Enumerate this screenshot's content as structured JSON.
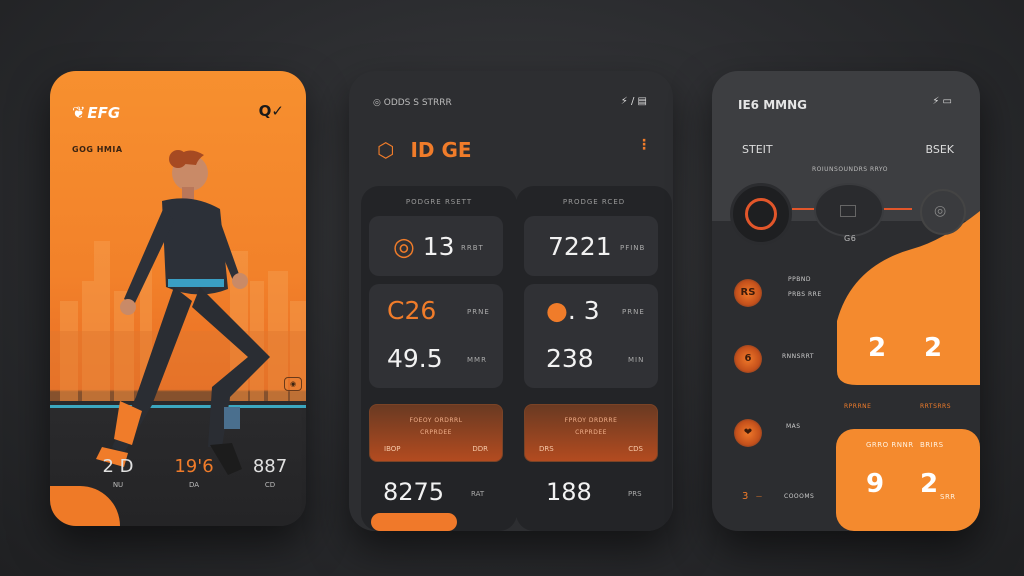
{
  "phone1": {
    "logo": "EFG",
    "search_label": "Q",
    "subtitle": "GOG HMIA",
    "stats": [
      {
        "value": "2 D",
        "label": "NU"
      },
      {
        "value": "19'6",
        "label": "DA"
      },
      {
        "value": "887",
        "label": "CD"
      }
    ]
  },
  "phone2": {
    "status_left": "ODDS S STRRR",
    "status_right": "⚡ / ▤",
    "title": "ID GE",
    "col1": {
      "caption": "PODGRE RSETT",
      "tile1": {
        "value": "13",
        "unit": "RRBT"
      },
      "tile2": {
        "value_a": "C26",
        "unit_a": "PRNE",
        "value_b": "49.5",
        "unit_b": "MMR"
      },
      "orange": {
        "title": "FOEOY ORDRRL",
        "sub": "CRPRDEE",
        "left": "IBOP",
        "right": "DDR"
      },
      "big": "8275",
      "big_unit": "RAT"
    },
    "col2": {
      "caption": "PRODGE RCED",
      "tile1": {
        "value": "7221",
        "unit": "PFINB"
      },
      "tile2": {
        "value_a": "3",
        "unit_a": "PRNE",
        "value_b": "238",
        "unit_b": "MIN"
      },
      "orange": {
        "title": "FPROY DRDRRE",
        "sub": "CRPRDEE",
        "left": "DRS",
        "right": "CDS"
      },
      "big": "188",
      "big_unit": "PRS"
    }
  },
  "phone3": {
    "status_left": "IE6 MMNG",
    "status_right": "⚡ ▭",
    "label_left": "STEIT",
    "label_right": "BSEK",
    "sub_caption": "ROIUNSOUNDRS RRYO",
    "ring_label": "G6",
    "rows": [
      {
        "icon": "RS",
        "label_a": "PPBND",
        "label_b": "PRBS RRE"
      },
      {
        "icon": "6",
        "label_a": "RNNSRRT"
      },
      {
        "icon": "❤",
        "label_a": "MAS"
      },
      {
        "icon": "3",
        "label_a": "COOOMS"
      }
    ],
    "card1": {
      "left": "2",
      "right": "2"
    },
    "mid_labels": {
      "a": "RPRRNE",
      "b": "RRTSRRS"
    },
    "card2": {
      "title_a": "GRRO RNNR",
      "title_b": "BRIRS",
      "left": "9",
      "right": "2",
      "suffix": "SRR"
    }
  },
  "colors": {
    "accent": "#f07c2a",
    "background": "#2a2b2e",
    "panel": "#232427",
    "track": "#41c7e6"
  }
}
